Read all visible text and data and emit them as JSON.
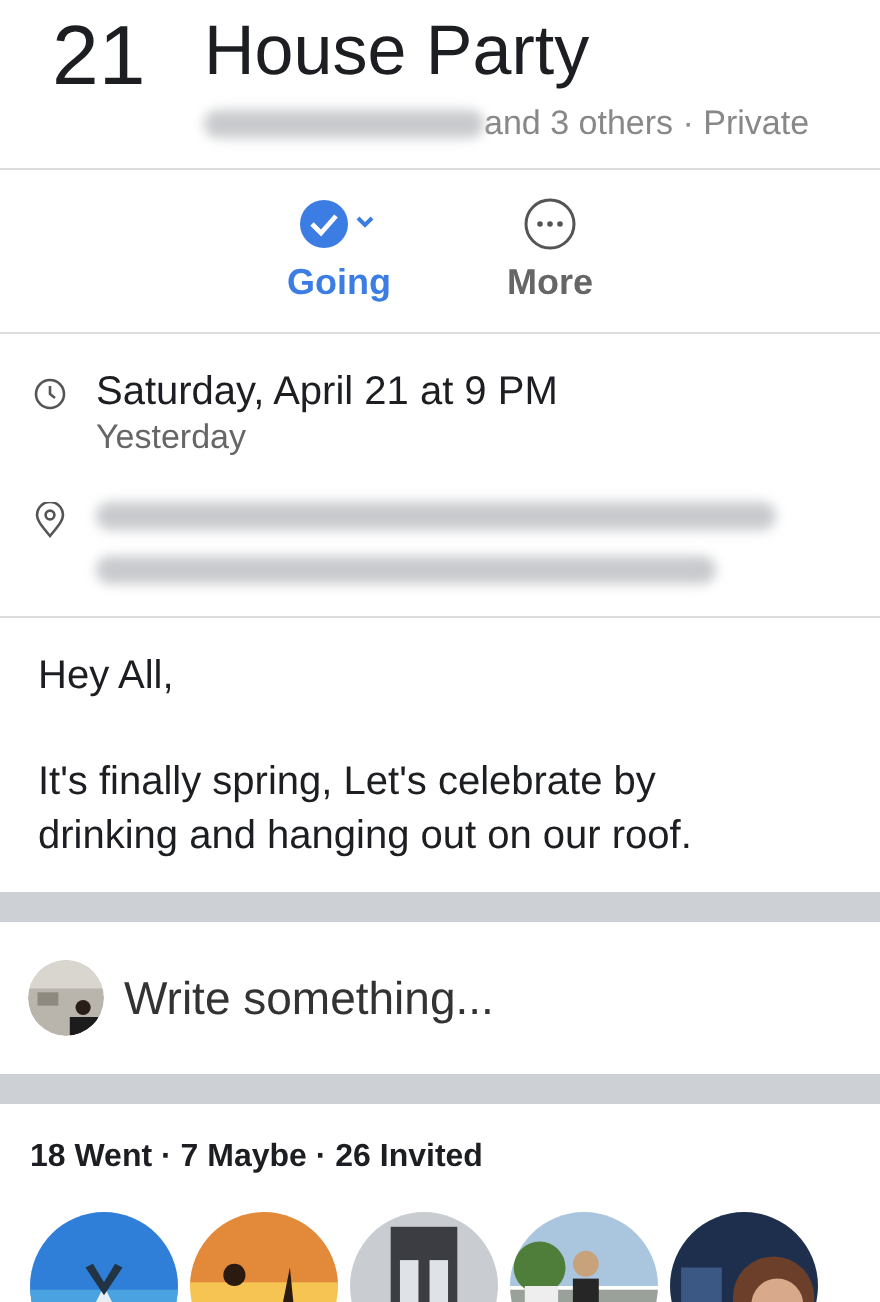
{
  "event": {
    "day": "21",
    "title": "House Party",
    "hosts": "and 3 others · Private"
  },
  "actions": [
    {
      "kind": "rsvp",
      "label": "Going",
      "selected": true
    },
    {
      "kind": "more",
      "label": "More",
      "selected": false
    }
  ],
  "details": [
    {
      "kind": "time",
      "text": "Saturday, April 21 at 9 PM",
      "subtext": "Yesterday"
    },
    {
      "kind": "location"
    }
  ],
  "description": [
    "Hey All,",
    "It's finally spring, Let's celebrate by drinking and hanging out on our roof."
  ],
  "composer": {
    "placeholder": "Write something..."
  },
  "guests": {
    "summary": "18 Went · 7 Maybe · 26 Invited"
  }
}
